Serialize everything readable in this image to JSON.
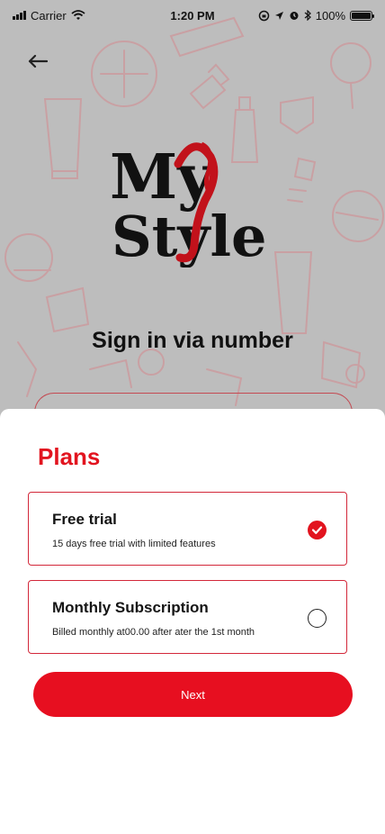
{
  "status_bar": {
    "carrier": "Carrier",
    "time": "1:20 PM",
    "battery": "100%",
    "battery_level": 1.0,
    "icons": [
      "signal-icon",
      "wifi-icon",
      "screen-lock-icon",
      "location-icon",
      "alarm-icon",
      "bluetooth-icon",
      "battery-icon"
    ]
  },
  "header": {
    "back_icon": "arrow-left-icon"
  },
  "logo": {
    "text_line1": "My",
    "text_line2": "Style",
    "accent_color": "#c2121b"
  },
  "signin": {
    "title": "Sign in via number"
  },
  "sheet": {
    "title": "Plans",
    "plans": [
      {
        "name": "Free trial",
        "description": "15 days free trial with limited features",
        "selected": true
      },
      {
        "name": "Monthly Subscription",
        "description": "Billed monthly at00.00 after ater the 1st month",
        "selected": false
      }
    ],
    "next_label": "Next"
  },
  "colors": {
    "accent": "#e2141f",
    "button": "#e70f20",
    "overlay_bg": "#bdbdbd"
  }
}
